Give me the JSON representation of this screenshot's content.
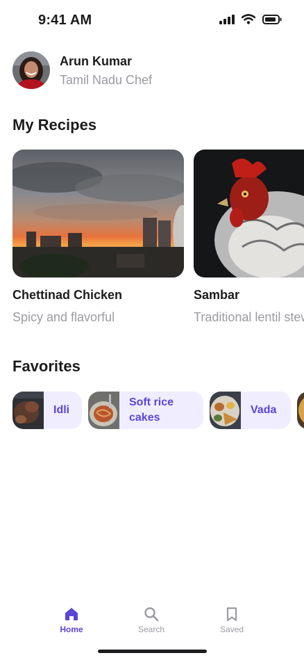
{
  "status": {
    "time": "9:41 AM"
  },
  "profile": {
    "name": "Arun Kumar",
    "subtitle": "Tamil Nadu Chef"
  },
  "sections": {
    "recipes_title": "My Recipes",
    "favorites_title": "Favorites"
  },
  "recipes": [
    {
      "title": "Chettinad Chicken",
      "description": "Spicy and flavorful",
      "image": "sunset-city-photo"
    },
    {
      "title": "Sambar",
      "description": "Traditional lentil stew",
      "image": "rooster-photo"
    }
  ],
  "favorites": [
    {
      "label": "Idli",
      "image": "grilled-meat-photo"
    },
    {
      "label": "Soft rice cakes",
      "image": "noodle-plate-photo"
    },
    {
      "label": "Vada",
      "image": "thali-plate-photo"
    }
  ],
  "tabs": [
    {
      "label": "Home",
      "icon": "home-icon",
      "active": true
    },
    {
      "label": "Search",
      "icon": "search-icon",
      "active": false
    },
    {
      "label": "Saved",
      "icon": "bookmark-icon",
      "active": false
    }
  ],
  "colors": {
    "accent": "#5b45d6",
    "chip_bg": "#efedff",
    "muted_text": "#9a9aa2"
  }
}
